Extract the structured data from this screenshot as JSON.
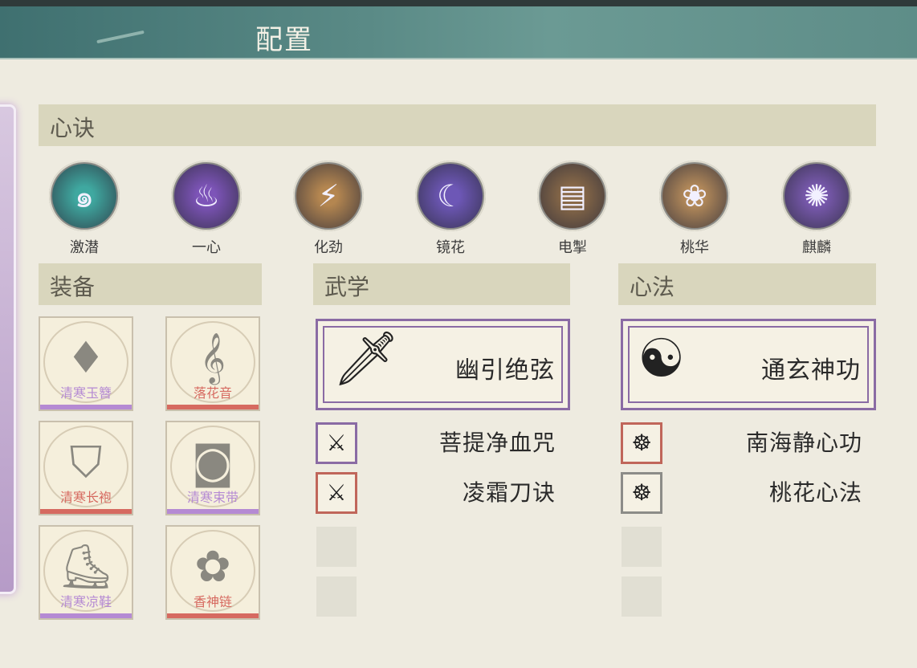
{
  "header": {
    "title": "配置"
  },
  "sections": {
    "xinjue": "心诀",
    "zhuangbei": "装备",
    "wuxue": "武学",
    "xinfa": "心法"
  },
  "skills": [
    {
      "label": "激潜",
      "color": "#3fa8a0",
      "icon": "swirl-icon"
    },
    {
      "label": "一心",
      "color": "#7d54b8",
      "icon": "flame-icon"
    },
    {
      "label": "化劲",
      "color": "#b48650",
      "icon": "strike-icon"
    },
    {
      "label": "镜花",
      "color": "#6d57b6",
      "icon": "moon-icon"
    },
    {
      "label": "电掣",
      "color": "#8a6a48",
      "icon": "scroll-icon"
    },
    {
      "label": "桃华",
      "color": "#b48a5a",
      "icon": "figure-icon"
    },
    {
      "label": "麒麟",
      "color": "#7a5ab0",
      "icon": "qilin-icon"
    }
  ],
  "equipment": [
    {
      "name": "清寒玉簪",
      "rarity": "#b58ad3",
      "glyph": "♦"
    },
    {
      "name": "落花音",
      "rarity": "#d66a60",
      "glyph": "𝄞"
    },
    {
      "name": "清寒长袍",
      "rarity": "#d66a60",
      "glyph": "⛉"
    },
    {
      "name": "清寒束带",
      "rarity": "#b58ad3",
      "glyph": "◙"
    },
    {
      "name": "清寒凉鞋",
      "rarity": "#b58ad3",
      "glyph": "⛸"
    },
    {
      "name": "香神链",
      "rarity": "#d66a60",
      "glyph": "✿"
    }
  ],
  "wuxue": {
    "main": "幽引绝弦",
    "subs": [
      {
        "name": "菩提净血咒",
        "border": "#8a6ba4"
      },
      {
        "name": "凌霜刀诀",
        "border": "#c0665a"
      }
    ]
  },
  "xinfa": {
    "main": "通玄神功",
    "subs": [
      {
        "name": "南海静心功",
        "border": "#c0665a"
      },
      {
        "name": "桃花心法",
        "border": "#8c8c88"
      }
    ]
  }
}
